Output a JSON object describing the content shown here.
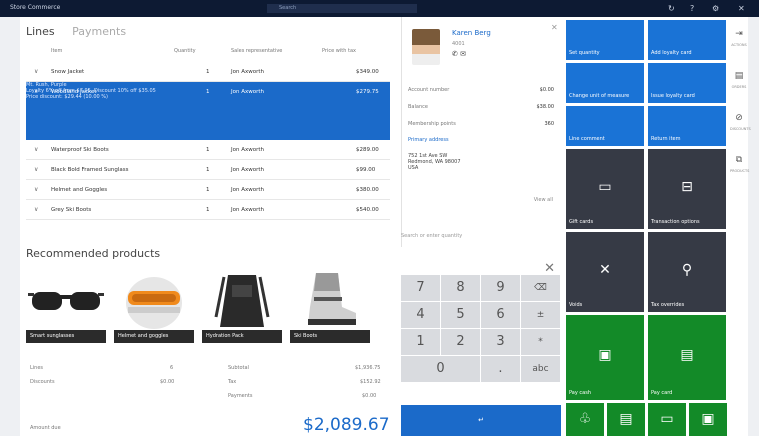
{
  "topbar": {
    "app": "Store Commerce",
    "search_placeholder": "Search"
  },
  "tabs": {
    "lines": "Lines",
    "payments": "Payments"
  },
  "columns": [
    "Item",
    "Quantity",
    "Sales representative",
    "Price with tax"
  ],
  "lines": [
    {
      "item": "Snow Jacket",
      "qty": "1",
      "rep": "Jon Axworth",
      "price": "$349.00"
    },
    {
      "item": "Woodland Jacket",
      "qty": "1",
      "rep": "Jon Axworth",
      "price": "$279.75",
      "selected": true,
      "details": [
        "Mt. Rush, Purple",
        "Loyalty 6% off from $7.95, Discount 10% off $35.05",
        "Price discount: $29.44 (10.00 %)"
      ]
    },
    {
      "item": "Waterproof Ski Boots",
      "qty": "1",
      "rep": "Jon Axworth",
      "price": "$289.00"
    },
    {
      "item": "Black Bold Framed Sunglass",
      "qty": "1",
      "rep": "Jon Axworth",
      "price": "$99.00"
    },
    {
      "item": "Helmet and Goggles",
      "qty": "1",
      "rep": "Jon Axworth",
      "price": "$380.00"
    },
    {
      "item": "Grey Ski Boots",
      "qty": "1",
      "rep": "Jon Axworth",
      "price": "$540.00"
    }
  ],
  "recommended": {
    "title": "Recommended products",
    "items": [
      "Smart sunglasses",
      "Helmet and goggles",
      "Hydration Pack",
      "Ski Boots"
    ]
  },
  "totals": {
    "lines_label": "Lines",
    "lines_value": "6",
    "discounts_label": "Discounts",
    "discounts_value": "$0.00",
    "subtotal_label": "Subtotal",
    "subtotal_value": "$1,936.75",
    "tax_label": "Tax",
    "tax_value": "$152.92",
    "payments_label": "Payments",
    "payments_value": "$0.00",
    "amount_due_label": "Amount due",
    "amount_due": "$2,089.67"
  },
  "customer": {
    "name": "Karen Berg",
    "sub": "4001",
    "fields": [
      {
        "label": "Account number",
        "value": "$0.00"
      },
      {
        "label": "Balance",
        "value": "$38.00"
      },
      {
        "label": "Membership points",
        "value": "360"
      }
    ],
    "primary_address_label": "Primary address",
    "address": [
      "752 1st Ave SW",
      "Redmond, WA 98007",
      "USA"
    ],
    "view_all": "View all"
  },
  "numpad": {
    "prompt": "Search or enter quantity",
    "keys": [
      "7",
      "8",
      "9",
      "⌫",
      "4",
      "5",
      "6",
      "±",
      "1",
      "2",
      "3",
      "*",
      "0",
      ".",
      "abc"
    ],
    "enter": "↵"
  },
  "tiles": [
    {
      "label": "Set quantity",
      "color": "blue"
    },
    {
      "label": "Add loyalty card",
      "color": "blue"
    },
    {
      "label": "Change unit of measure",
      "color": "blue"
    },
    {
      "label": "Issue loyalty card",
      "color": "blue"
    },
    {
      "label": "Line comment",
      "color": "blue"
    },
    {
      "label": "Return item",
      "color": "blue"
    },
    {
      "label": "Gift cards",
      "color": "dark",
      "icon": "▭"
    },
    {
      "label": "Transaction options",
      "color": "dark",
      "icon": "⊟"
    },
    {
      "label": "Voids",
      "color": "dark",
      "icon": "✕"
    },
    {
      "label": "Tax overrides",
      "color": "dark",
      "icon": "⚲"
    },
    {
      "label": "Pay cash",
      "color": "green",
      "icon": "▣"
    },
    {
      "label": "Pay card",
      "color": "green",
      "icon": "▤"
    }
  ],
  "side": [
    {
      "icon": "⇥",
      "label": "ACTIONS"
    },
    {
      "icon": "▤",
      "label": "ORDERS"
    },
    {
      "icon": "⊘",
      "label": "DISCOUNTS"
    },
    {
      "icon": "⧉",
      "label": "PRODUCTS"
    }
  ]
}
